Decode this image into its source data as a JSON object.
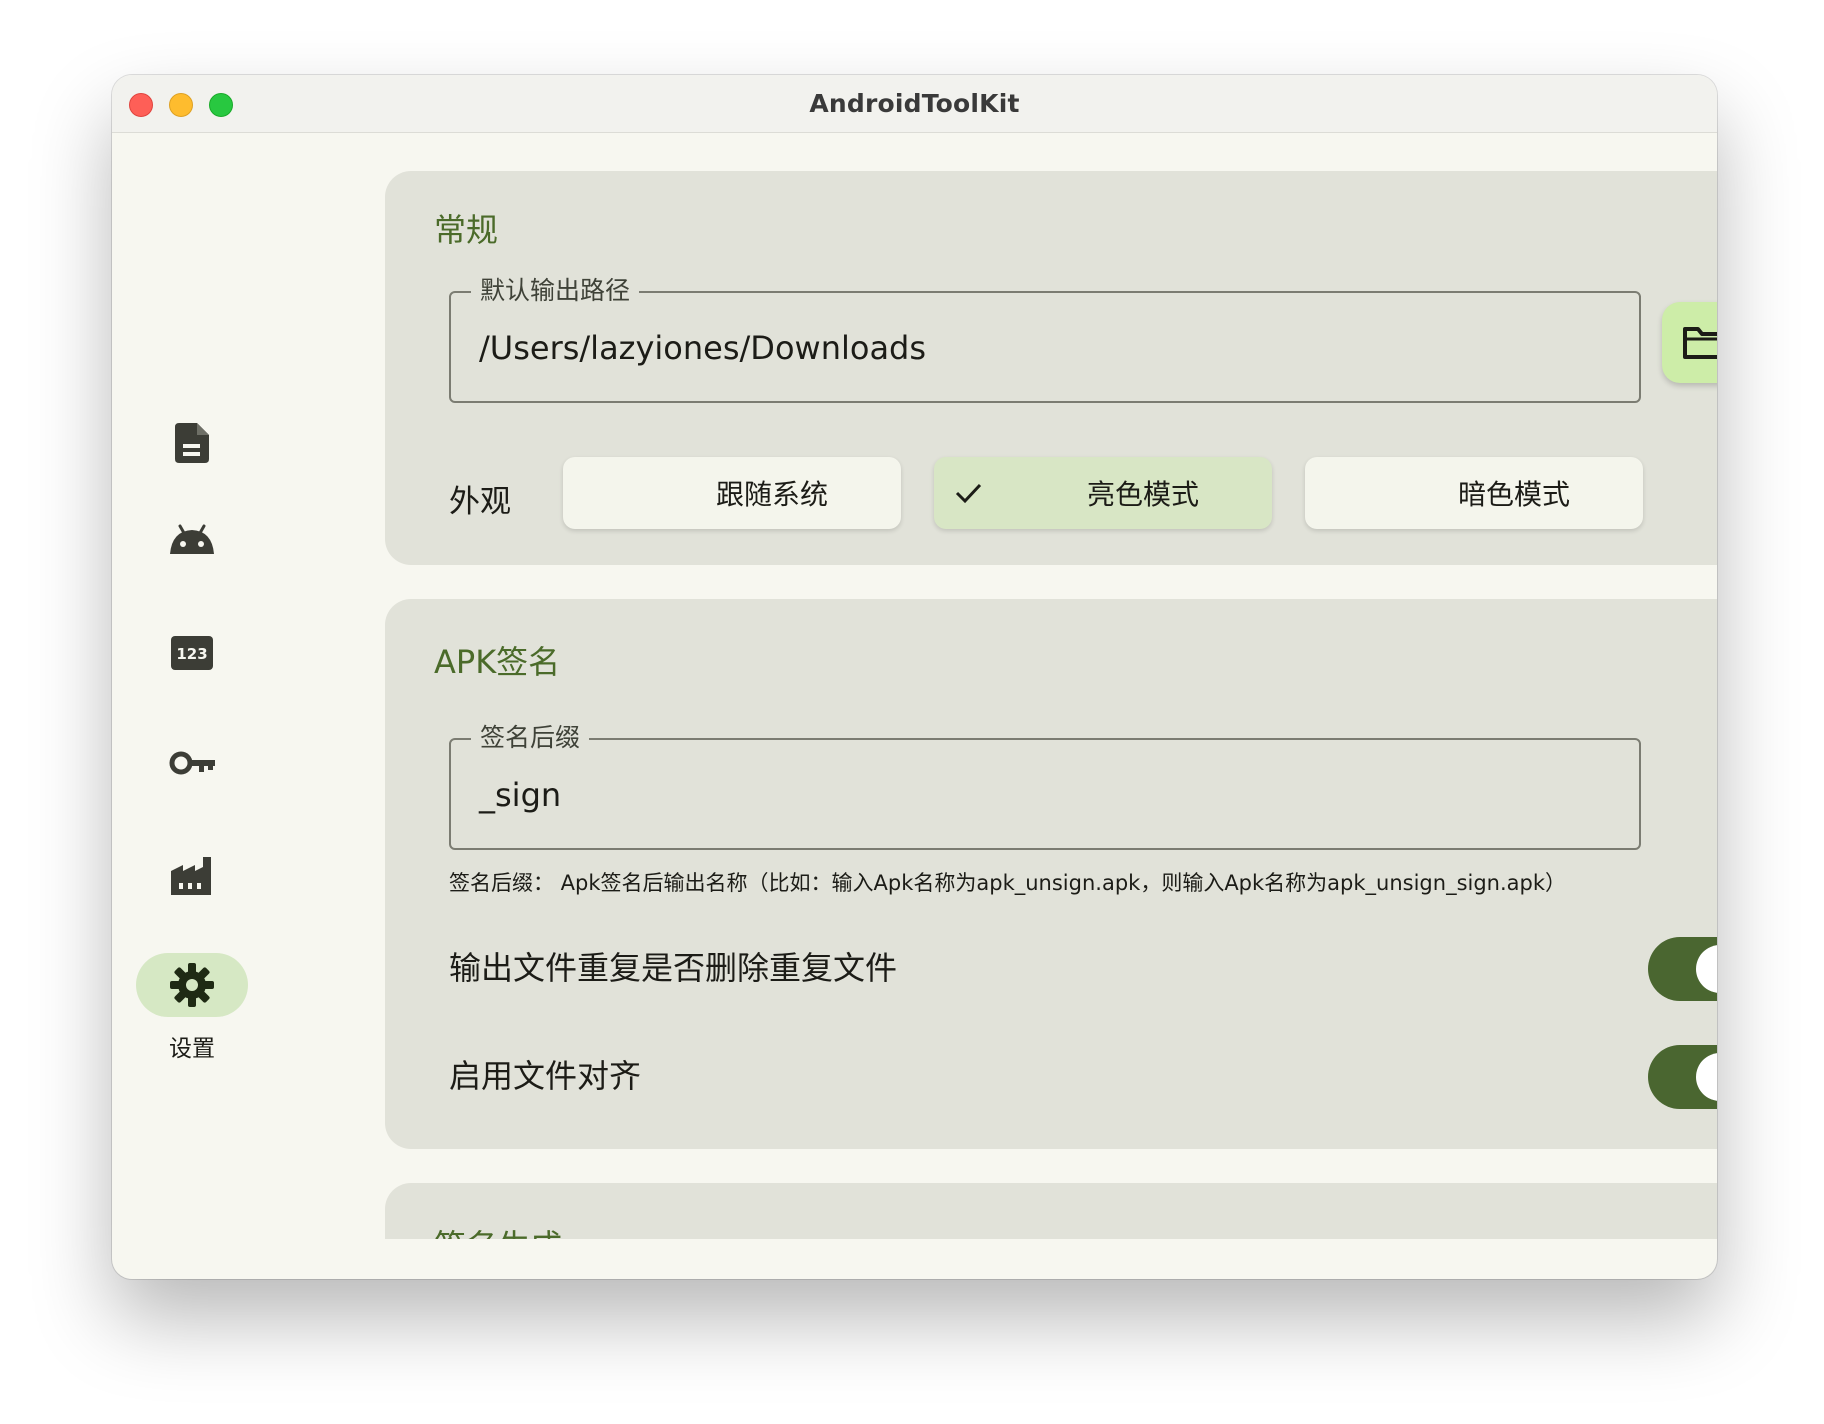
{
  "window": {
    "title": "AndroidToolKit"
  },
  "sidebar": {
    "items": [
      {
        "icon": "document-icon"
      },
      {
        "icon": "android-icon"
      },
      {
        "icon": "number-123-icon"
      },
      {
        "icon": "key-icon"
      },
      {
        "icon": "factory-icon"
      },
      {
        "icon": "gear-icon",
        "label": "设置",
        "active": true
      }
    ]
  },
  "general": {
    "title": "常规",
    "output_path": {
      "label": "默认输出路径",
      "value": "/Users/lazyiones/Downloads"
    },
    "folder_button_icon": "folder-icon",
    "appearance": {
      "label": "外观",
      "options": [
        {
          "label": "跟随系统",
          "selected": false
        },
        {
          "label": "亮色模式",
          "selected": true
        },
        {
          "label": "暗色模式",
          "selected": false
        }
      ]
    }
  },
  "apk_sign": {
    "title": "APK签名",
    "suffix": {
      "label": "签名后缀",
      "value": "_sign"
    },
    "helper": "签名后缀： Apk签名后输出名称（比如：输入Apk名称为apk_unsign.apk，则输入Apk名称为apk_unsign_sign.apk）",
    "toggles": [
      {
        "label": "输出文件重复是否删除重复文件",
        "on": true
      },
      {
        "label": "启用文件对齐",
        "on": true
      }
    ]
  },
  "sign_generate": {
    "title": "签名生成"
  },
  "colors": {
    "accent": "#4a6630",
    "title_green": "#4b6b2a",
    "card_bg": "#e1e2d9",
    "selected_bg": "#d8e6c5",
    "folder_button_bg": "#cdeda8"
  }
}
